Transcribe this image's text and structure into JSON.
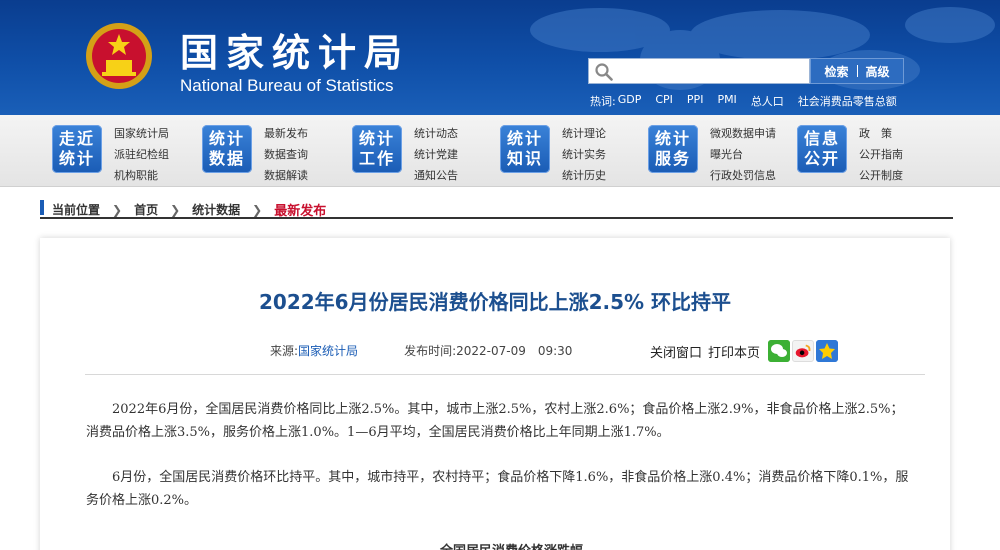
{
  "header": {
    "title_cn": "国家统计局",
    "title_en": "National Bureau of Statistics",
    "search": {
      "placeholder": "",
      "btn_search": "检索",
      "btn_advanced": "高级"
    },
    "hot_label": "热词:",
    "hot_words": [
      "GDP",
      "CPI",
      "PPI",
      "PMI",
      "总人口",
      "社会消费品零售总额"
    ]
  },
  "nav": [
    {
      "badge": "走近\n统计",
      "links": [
        "国家统计局",
        "派驻纪检组",
        "机构职能"
      ]
    },
    {
      "badge": "统计\n数据",
      "links": [
        "最新发布",
        "数据查询",
        "数据解读"
      ]
    },
    {
      "badge": "统计\n工作",
      "links": [
        "统计动态",
        "统计党建",
        "通知公告"
      ]
    },
    {
      "badge": "统计\n知识",
      "links": [
        "统计理论",
        "统计实务",
        "统计历史"
      ]
    },
    {
      "badge": "统计\n服务",
      "links": [
        "微观数据申请",
        "曝光台",
        "行政处罚信息"
      ]
    },
    {
      "badge": "信息\n公开",
      "links": [
        "政　策",
        "公开指南",
        "公开制度"
      ]
    }
  ],
  "breadcrumb": {
    "label": "当前位置",
    "items": [
      "首页",
      "统计数据"
    ],
    "current": "最新发布"
  },
  "article": {
    "title": "2022年6月份居民消费价格同比上涨2.5%  环比持平",
    "source_label": "来源:",
    "source": "国家统计局",
    "time_label": "发布时间:",
    "time": "2022-07-09　09:30",
    "tool_close": "关闭窗口",
    "tool_print": "打印本页",
    "paragraphs": [
      "2022年6月份，全国居民消费价格同比上涨2.5%。其中，城市上涨2.5%，农村上涨2.6%；食品价格上涨2.9%，非食品价格上涨2.5%；消费品价格上涨3.5%，服务价格上涨1.0%。1—6月平均，全国居民消费价格比上年同期上涨1.7%。",
      "6月份，全国居民消费价格环比持平。其中，城市持平，农村持平；食品价格下降1.6%，非食品价格上涨0.4%；消费品价格下降0.1%，服务价格上涨0.2%。"
    ],
    "next_heading": "全国居民消费价格涨跌幅"
  },
  "colors": {
    "header_blue": "#0f4fa8",
    "title_blue": "#1c4f8f",
    "current_red": "#c8102e"
  }
}
